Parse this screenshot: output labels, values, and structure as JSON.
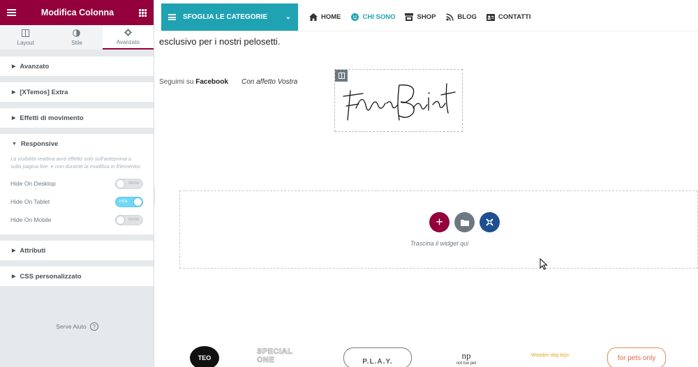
{
  "panel": {
    "title": "Modifica Colonna",
    "accent": "#93003c",
    "tabs": [
      {
        "label": "Layout",
        "icon": "columns-icon"
      },
      {
        "label": "Stile",
        "icon": "contrast-icon"
      },
      {
        "label": "Avanzato",
        "icon": "gear-icon",
        "active": true
      }
    ],
    "sections": {
      "avanzato": "Avanzato",
      "extra": "[XTemos] Extra",
      "movimento": "Effetti di movimento",
      "responsive": "Responsive",
      "attributi": "Attributi",
      "css": "CSS personalizzato"
    },
    "responsive_note": "La visibilità reattiva avrà effetto solo sull'anteprima o sulla pagina live, e non durante la modifica in Elementor.",
    "toggles": [
      {
        "label": "Hide On Desktop",
        "state": "SHOW",
        "on": false
      },
      {
        "label": "Hide On Tablet",
        "state": "HIDE",
        "on": true
      },
      {
        "label": "Hide On Mobile",
        "state": "SHOW",
        "on": false
      }
    ],
    "help": "Serve Aiuto",
    "help_icon": "?"
  },
  "nav": {
    "categories_label": "SFOGLIA LE CATEGORIE",
    "brand_color": "#1fa3b3",
    "items": [
      {
        "label": "HOME",
        "icon": "home-icon"
      },
      {
        "label": "CHI SONO",
        "icon": "smile-icon",
        "active": true
      },
      {
        "label": "SHOP",
        "icon": "store-icon"
      },
      {
        "label": "BLOG",
        "icon": "feed-icon"
      },
      {
        "label": "CONTATTI",
        "icon": "contact-card-icon"
      }
    ]
  },
  "content": {
    "intro": "esclusivo per i nostri pelosetti.",
    "follow_prefix": "Seguimi su",
    "follow_link": "Facebook",
    "affetto": "Con affetto Vostra"
  },
  "dropzone": {
    "text": "Trascina il widget qui"
  },
  "logos": [
    "TEO",
    "SPECIAL ONE",
    "P.L.A.Y.",
    "not too pet",
    "Wooden dog toys",
    "for pets only"
  ]
}
